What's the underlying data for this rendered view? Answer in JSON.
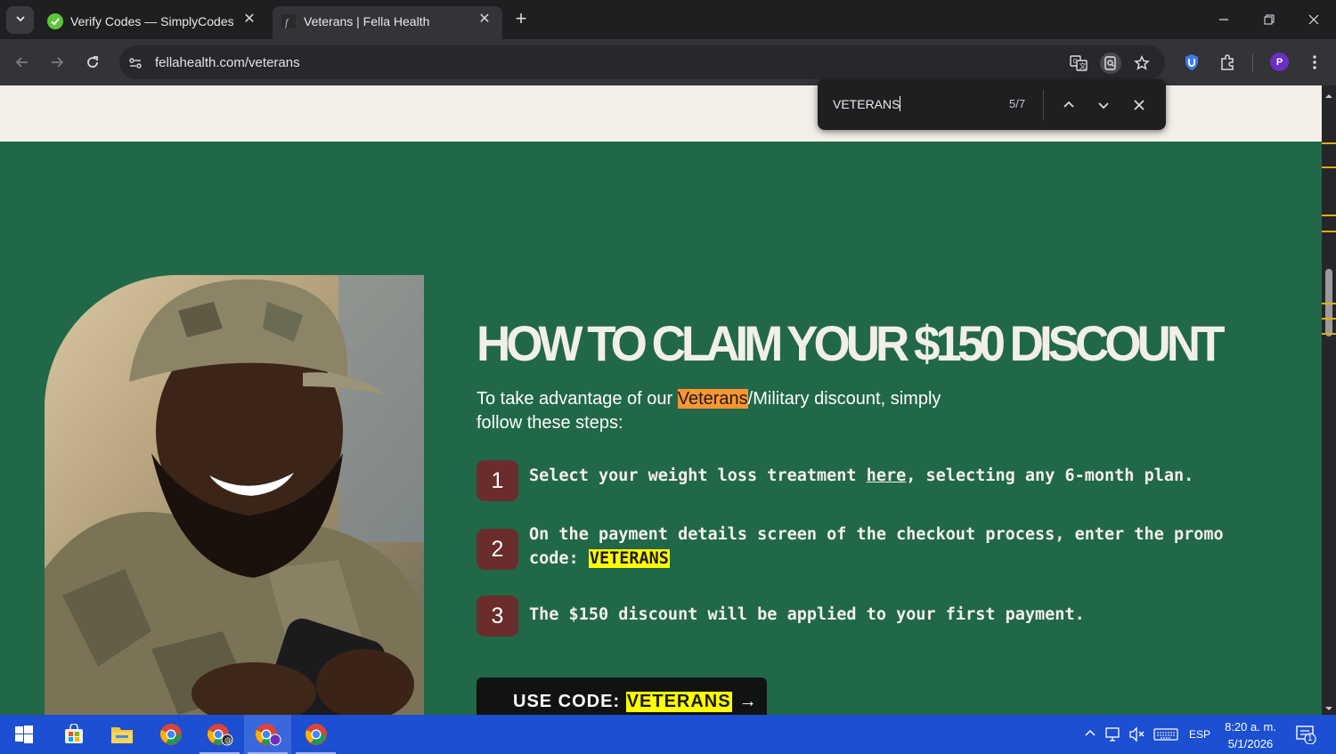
{
  "browser": {
    "tabs": [
      {
        "title": "Verify Codes — SimplyCodes",
        "active": false
      },
      {
        "title": "Veterans | Fella Health",
        "active": true
      }
    ],
    "url": "fellahealth.com/veterans",
    "profile_initial": "P"
  },
  "find_bar": {
    "query": "VETERANS",
    "count": "5/7"
  },
  "page": {
    "headline": "HOW TO CLAIM YOUR $150 DISCOUNT",
    "intro_before": "To take advantage of our ",
    "intro_highlight": "Veterans",
    "intro_after": "/Military discount, simply follow these steps:",
    "steps": [
      {
        "number": "1",
        "before": "Select your weight loss treatment ",
        "link": "here",
        "after": ", selecting any 6-month plan."
      },
      {
        "number": "2",
        "before": "On the payment details screen of the checkout process, enter the promo code: ",
        "code": "VETERANS"
      },
      {
        "number": "3",
        "before": "The $150 discount will be applied to your first payment."
      }
    ],
    "cta_prefix": "USE CODE: ",
    "cta_code": "VETERANS",
    "cta_arrow": "→"
  },
  "taskbar": {
    "language": "ESP",
    "time": "8:20 a. m.",
    "date": "5/1/2026",
    "notification_count": "1"
  },
  "colors": {
    "page_green": "#216848",
    "badge_red": "#6b2c2c",
    "highlight_current": "#ff9632",
    "highlight": "#ffff00",
    "taskbar_blue": "#1c4fd1"
  }
}
